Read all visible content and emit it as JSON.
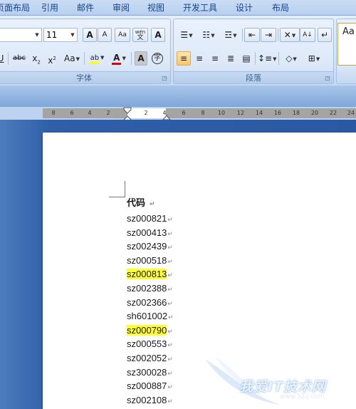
{
  "tabs": [
    {
      "label": "页面布局"
    },
    {
      "label": "引用"
    },
    {
      "label": "邮件"
    },
    {
      "label": "审阅"
    },
    {
      "label": "视图"
    },
    {
      "label": "开发工具"
    },
    {
      "label": "设计"
    },
    {
      "label": "布局"
    }
  ],
  "font_group": {
    "label": "字体",
    "font_name_value": "",
    "font_size_value": "11",
    "grow_font": "A",
    "shrink_font": "A",
    "clear_format": "Aa",
    "phonetic_top": "wén",
    "phonetic_bottom": "文",
    "char_border": "A",
    "underline": "U",
    "strike": "abc",
    "subscript": "x",
    "superscript": "x",
    "change_case": "Aa",
    "highlight": "ab",
    "font_color": "A",
    "char_shading": "A",
    "enclose": "字"
  },
  "paragraph_group": {
    "label": "段落"
  },
  "styles_group": {
    "sample": "Aa"
  },
  "ruler": {
    "ticks": [
      "8",
      "6",
      "4",
      "2",
      "2",
      "4",
      "6",
      "8",
      "10",
      "12",
      "14",
      "16",
      "18",
      "20",
      "22",
      "24"
    ]
  },
  "document": {
    "header": "代码",
    "lines": [
      {
        "text": "sz000821",
        "highlight": false
      },
      {
        "text": "sz000413",
        "highlight": false
      },
      {
        "text": "sz002439",
        "highlight": false
      },
      {
        "text": "sz000518",
        "highlight": false
      },
      {
        "text": "sz000813",
        "highlight": true
      },
      {
        "text": "sz002388",
        "highlight": false
      },
      {
        "text": "sz002366",
        "highlight": false
      },
      {
        "text": "sh601002",
        "highlight": false
      },
      {
        "text": "sz000790",
        "highlight": true
      },
      {
        "text": "sz000553",
        "highlight": false
      },
      {
        "text": "sz002052",
        "highlight": false
      },
      {
        "text": "sz300028",
        "highlight": false
      },
      {
        "text": "sz000887",
        "highlight": false
      },
      {
        "text": "sz002108",
        "highlight": false
      }
    ],
    "paragraph_mark": "↵"
  },
  "watermark": {
    "text": "我爱IT技术网",
    "url": "www.52ij.com"
  },
  "colors": {
    "highlight": "#ffff33",
    "font_color_bar": "#e00000",
    "highlight_bar": "#ffff00",
    "workspace": "#2a59a3"
  }
}
